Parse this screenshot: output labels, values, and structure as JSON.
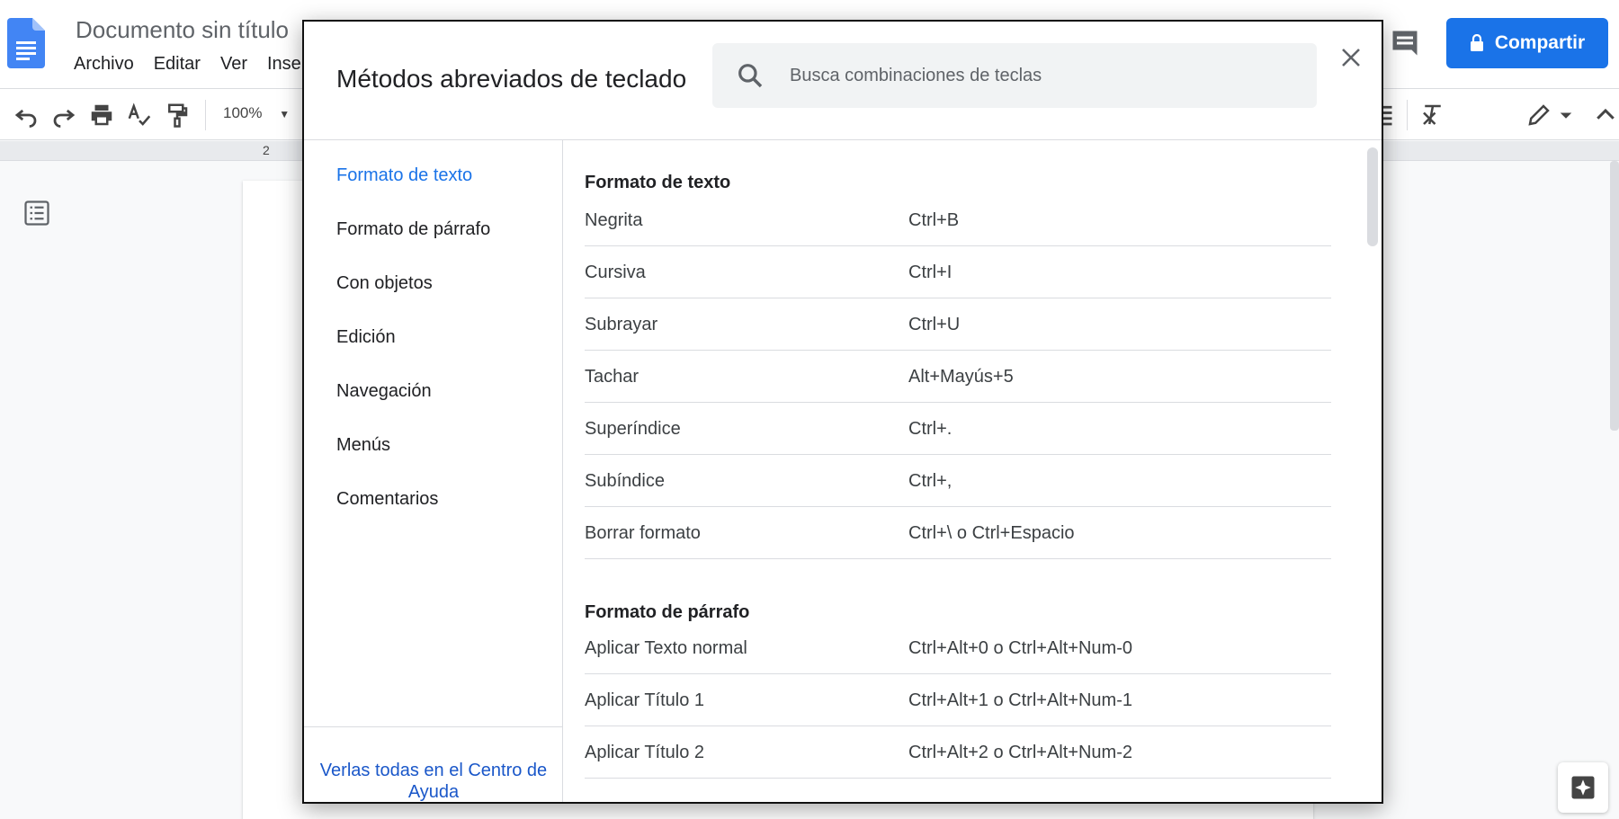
{
  "app": {
    "doc_title": "Documento sin título",
    "menus": [
      "Archivo",
      "Editar",
      "Ver",
      "Insertar"
    ],
    "share_label": "Compartir",
    "zoom": "100%",
    "ruler_mark": "2",
    "accent": "#1a73e8"
  },
  "dialog": {
    "title": "Métodos abreviados de teclado",
    "search_placeholder": "Busca combinaciones de teclas",
    "nav": [
      "Formato de texto",
      "Formato de párrafo",
      "Con objetos",
      "Edición",
      "Navegación",
      "Menús",
      "Comentarios"
    ],
    "active_nav": "Formato de texto",
    "help_link": "Verlas todas en el Centro de Ayuda",
    "sections": [
      {
        "title": "Formato de texto",
        "rows": [
          {
            "action": "Negrita",
            "keys": "Ctrl+B"
          },
          {
            "action": "Cursiva",
            "keys": "Ctrl+I"
          },
          {
            "action": "Subrayar",
            "keys": "Ctrl+U"
          },
          {
            "action": "Tachar",
            "keys": "Alt+Mayús+5"
          },
          {
            "action": "Superíndice",
            "keys": "Ctrl+."
          },
          {
            "action": "Subíndice",
            "keys": "Ctrl+,"
          },
          {
            "action": "Borrar formato",
            "keys": "Ctrl+\\ o Ctrl+Espacio"
          }
        ]
      },
      {
        "title": "Formato de párrafo",
        "rows": [
          {
            "action": "Aplicar Texto normal",
            "keys": "Ctrl+Alt+0 o Ctrl+Alt+Num-0"
          },
          {
            "action": "Aplicar Título 1",
            "keys": "Ctrl+Alt+1 o Ctrl+Alt+Num-1"
          },
          {
            "action": "Aplicar Título 2",
            "keys": "Ctrl+Alt+2 o Ctrl+Alt+Num-2"
          }
        ]
      }
    ]
  }
}
